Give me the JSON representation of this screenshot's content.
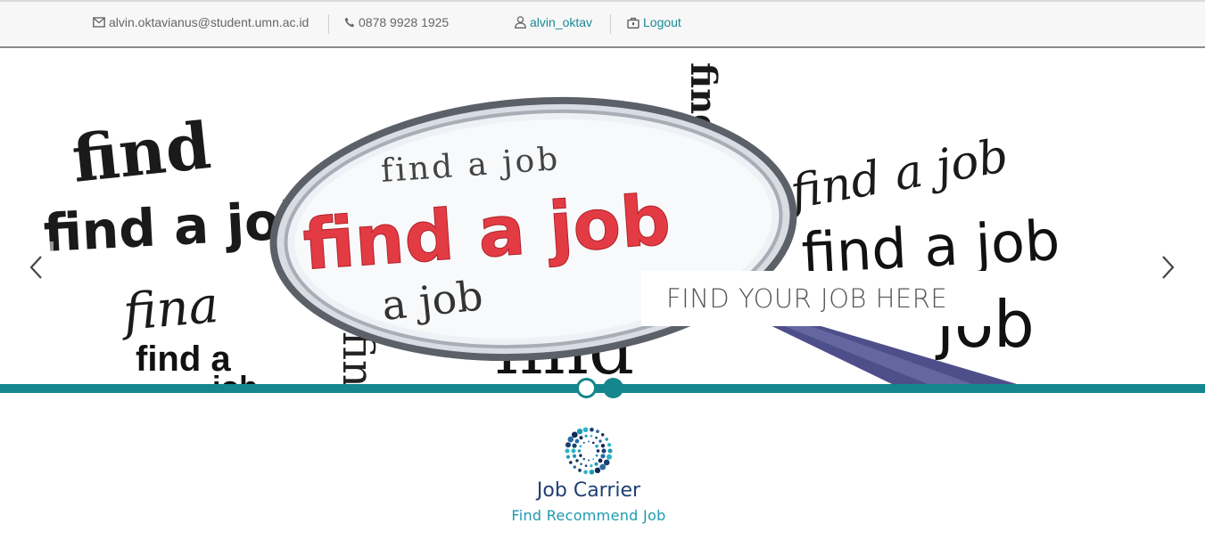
{
  "topbar": {
    "email": "alvin.oktavianus@student.umn.ac.id",
    "phone": "0878 9928 1925",
    "username": "alvin_oktav",
    "logout_label": "Logout",
    "link_color": "#1a8a96"
  },
  "slider": {
    "caption": "FIND YOUR JOB HERE",
    "image_words": {
      "big_red": "find a job",
      "lens_top": "find a job",
      "lens_bottom": "a job",
      "phrase": "find a job",
      "short_find": "find",
      "short_job": "job",
      "short_find_a": "find a",
      "short_fina": "fina"
    },
    "prev_icon": "chevron-left-icon",
    "next_icon": "chevron-right-icon",
    "active_slide": 2,
    "slide_count": 2,
    "accent_color": "#15868d"
  },
  "logo": {
    "title": "Job Carrier",
    "subtitle": "Find Recommend Job",
    "title_color": "#1c3f73",
    "subtitle_color": "#1e9ab0"
  }
}
